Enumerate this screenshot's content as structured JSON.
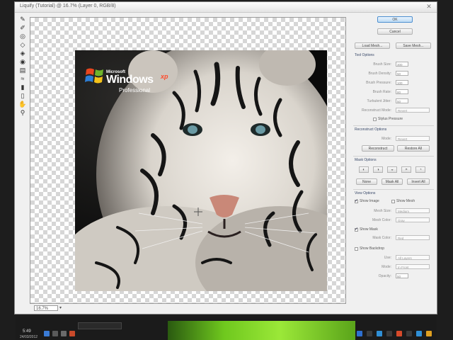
{
  "window": {
    "title": "Liquify (Tutorial) @ 16.7% (Layer 0, RGB/8)",
    "close_glyph": "✕"
  },
  "toolbox": {
    "tools": [
      "forward-warp-tool",
      "reconstruct-tool",
      "twirl-tool",
      "pucker-tool",
      "bloat-tool",
      "push-left-tool",
      "mirror-tool",
      "turbulence-tool",
      "freeze-mask-tool",
      "thaw-mask-tool",
      "hand-tool",
      "zoom-tool"
    ]
  },
  "canvas": {
    "watermark": {
      "brand": "Microsoft",
      "name": "Windows",
      "edition_tag": "xp",
      "edition": "Professional"
    }
  },
  "statusbar": {
    "zoom": "16.7%",
    "zoom_arrow": "▾"
  },
  "panel": {
    "ok_label": "OK",
    "cancel_label": "Cancel",
    "load_mesh_label": "Load Mesh...",
    "save_mesh_label": "Save Mesh...",
    "tool_options_title": "Tool Options",
    "brush_size_label": "Brush Size:",
    "brush_size_value": "300",
    "brush_density_label": "Brush Density:",
    "brush_density_value": "50",
    "brush_pressure_label": "Brush Pressure:",
    "brush_pressure_value": "100",
    "brush_rate_label": "Brush Rate:",
    "brush_rate_value": "80",
    "turbulent_jitter_label": "Turbulent Jitter:",
    "turbulent_jitter_value": "50",
    "reconstruct_mode_label": "Reconstruct Mode:",
    "reconstruct_mode_value": "Revert",
    "stylus_pressure_label": "Stylus Pressure",
    "reconstruct_options_title": "Reconstruct Options",
    "mode_label": "Mode:",
    "mode_value": "Revert",
    "reconstruct_label": "Reconstruct",
    "restore_all_label": "Restore All",
    "mask_options_title": "Mask Options",
    "none_label": "None",
    "mask_all_label": "Mask All",
    "invert_all_label": "Invert All",
    "view_options_title": "View Options",
    "show_image_label": "Show Image",
    "show_mesh_label": "Show Mesh",
    "mesh_size_label": "Mesh Size:",
    "mesh_size_value": "Medium",
    "mesh_color_label": "Mesh Color:",
    "mesh_color_value": "Gray",
    "show_mask_label": "Show Mask",
    "mask_color_label": "Mask Color:",
    "mask_color_value": "Red",
    "show_backdrop_label": "Show Backdrop",
    "use_label": "Use:",
    "use_value": "All Layers",
    "backdrop_mode_label": "Mode:",
    "backdrop_mode_value": "In Front",
    "opacity_label": "Opacity:",
    "opacity_value": "50",
    "checks": {
      "stylus_pressure": false,
      "show_image": true,
      "show_mesh": false,
      "show_mask": true,
      "show_backdrop": false
    }
  },
  "taskbar": {
    "time": "5:49",
    "date": "24/03/2012"
  },
  "colors": {
    "accent": "#4d8fd0",
    "taskbar": "#1b1b1b",
    "taskbar_green": "#6fc81e",
    "xp_red": "#ff4a2b"
  }
}
